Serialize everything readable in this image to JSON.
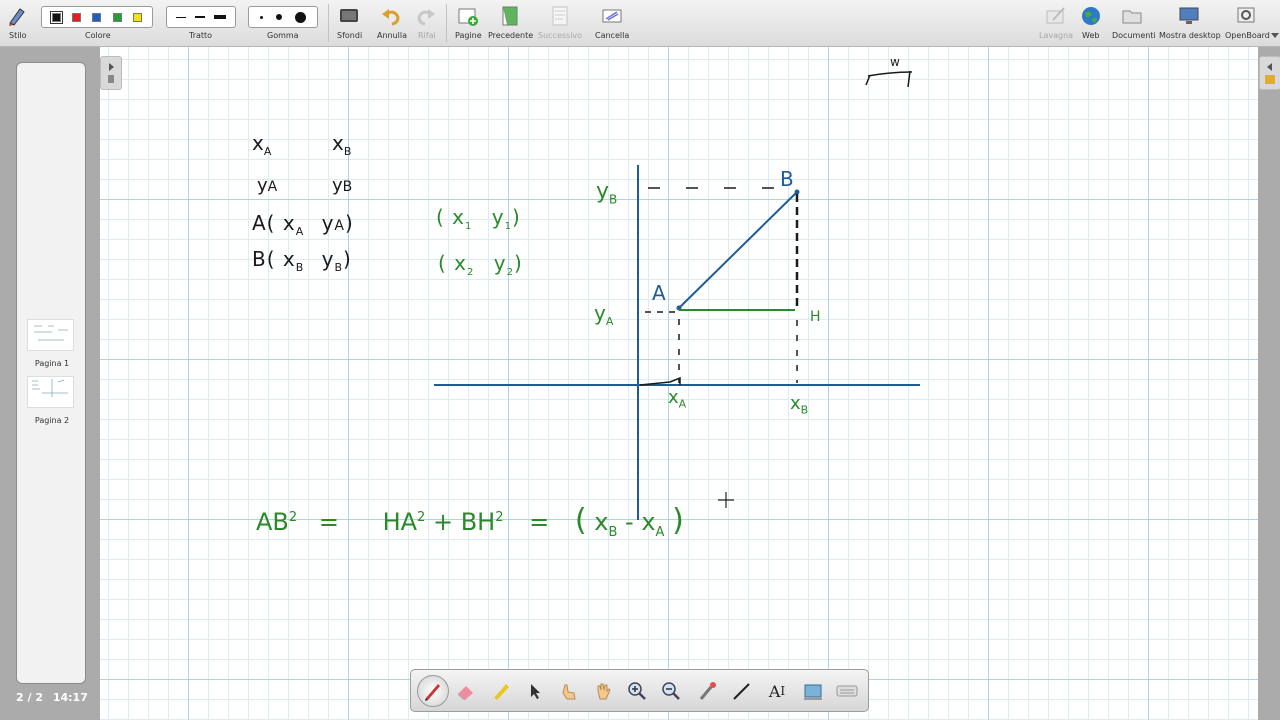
{
  "toolbar": {
    "stylus_label": "Stilo",
    "color_label": "Colore",
    "stroke_label": "Tratto",
    "eraser_label": "Gomma",
    "backgrounds_label": "Sfondi",
    "undo_label": "Annulla",
    "redo_label": "Rifai",
    "pages_label": "Pagine",
    "previous_label": "Precedente",
    "next_label": "Successivo",
    "clear_label": "Cancella",
    "board_label": "Lavagna",
    "web_label": "Web",
    "documents_label": "Documenti",
    "show_desktop_label": "Mostra desktop",
    "openboard_label": "OpenBoard",
    "colors": [
      "#111111",
      "#e02020",
      "#1f5fbf",
      "#22a036",
      "#f0e020"
    ]
  },
  "pages": [
    {
      "label": "Pagina 1"
    },
    {
      "label": "Pagina 2"
    }
  ],
  "status": {
    "page_indicator": "2 / 2",
    "time": "14:17"
  },
  "board": {
    "ink_blue": "#1d5c96",
    "ink_green": "#2a8a2a",
    "ink_black": "#1a1a1a",
    "handwriting": {
      "xA": "x",
      "xA_sub": "A",
      "xB": "x",
      "xB_sub": "B",
      "yA": "y",
      "yA_sub": "A",
      "yB": "y",
      "yB_sub": "B",
      "pointA_def": "A( x",
      "pointA_def_sub": "A",
      "pointA_def_tail": "y",
      "pointA_def_tail_sub": "A",
      "pointA_def_close": ")",
      "pointB_def": "B( x",
      "pointB_def_sub": "B",
      "pointB_def_tail": "y",
      "pointB_def_tail_sub": "B",
      "pointB_def_close": ")",
      "x1y1": "( x",
      "x1y1_s1": "1",
      "x1y1_mid": "y",
      "x1y1_s2": "1",
      "x1y1_close": ")",
      "x2y2": "( x",
      "x2y2_s1": "2",
      "x2y2_mid": "y",
      "x2y2_s2": "2",
      "x2y2_close": ")",
      "label_A": "A",
      "label_B": "B",
      "label_H": "H",
      "axis_yA": "y",
      "axis_yA_sub": "A",
      "axis_yB": "y",
      "axis_yB_sub": "B",
      "axis_xA": "x",
      "axis_xA_sub": "A",
      "axis_xB": "x",
      "axis_xB_sub": "B",
      "formula_AB": "AB",
      "formula_sq": "2",
      "formula_eq": "=",
      "formula_HA": "HA",
      "formula_plus": "+",
      "formula_BH": "BH",
      "formula_eq2": "=",
      "formula_paren_open": "(",
      "formula_xB": "x",
      "formula_xB_sub": "B",
      "formula_minus": "-",
      "formula_xA": "x",
      "formula_xA_sub": "A",
      "formula_paren_close": ")",
      "corner_mark": "w"
    }
  }
}
